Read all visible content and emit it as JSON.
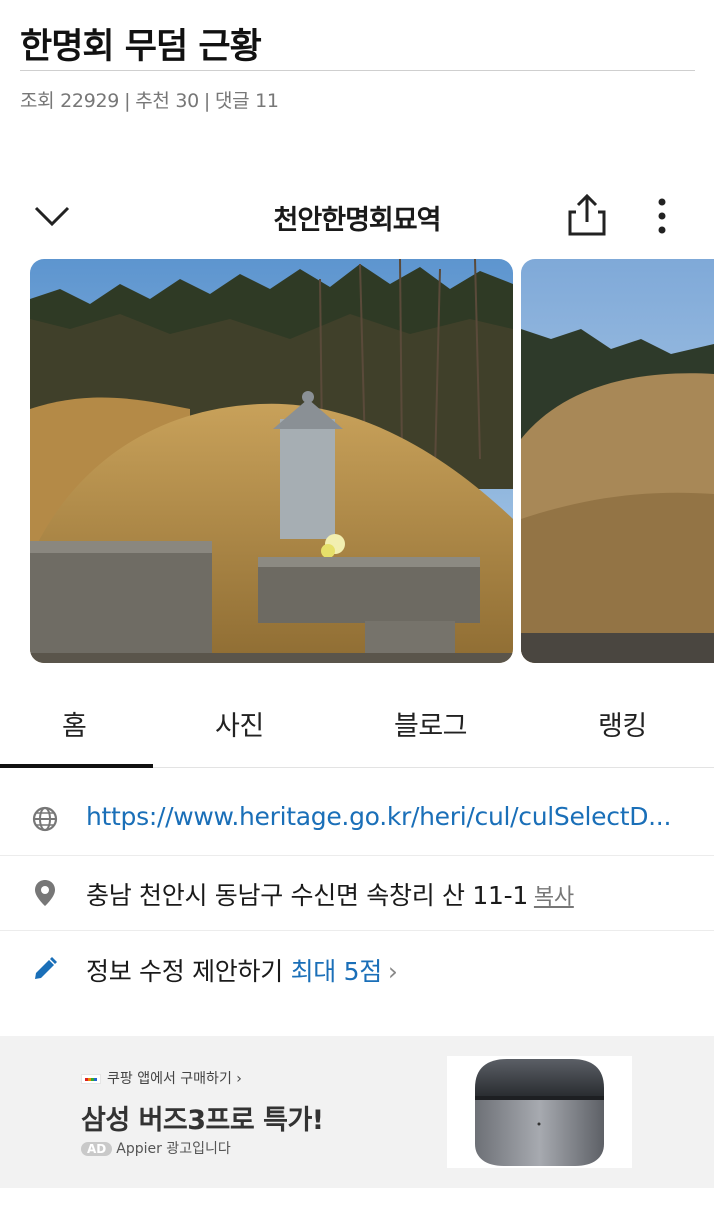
{
  "post": {
    "title": "한명회 무덤 근황",
    "views_label": "조회",
    "views": "22929",
    "likes_label": "추천",
    "likes": "30",
    "comments_label": "댓글",
    "comments": "11",
    "separator": "|"
  },
  "place": {
    "name": "천안한명회묘역",
    "icons": [
      "chevron-down-icon",
      "share-icon",
      "more-vertical-icon"
    ]
  },
  "tabs": [
    {
      "label": "홈",
      "active": true
    },
    {
      "label": "사진",
      "active": false
    },
    {
      "label": "블로그",
      "active": false
    },
    {
      "label": "랭킹",
      "active": false
    }
  ],
  "info": {
    "url": "https://www.heritage.go.kr/heri/cul/culSelectD...",
    "address": "충남 천안시 동남구 수신면 속창리 산 11-1",
    "copy_label": "복사",
    "suggest_label": "정보 수정 제안하기",
    "suggest_reward": "최대 5점",
    "suggest_arrow": "›"
  },
  "ad": {
    "source": "쿠팡 앱에서 구매하기 ›",
    "headline": "삼성 버즈3프로 특가!",
    "badge": "AD",
    "advertiser": "Appier 광고입니다"
  },
  "colors": {
    "accent_link": "#1a6fb8",
    "tab_indicator": "#111111",
    "ad_background": "#f2f2f2"
  }
}
